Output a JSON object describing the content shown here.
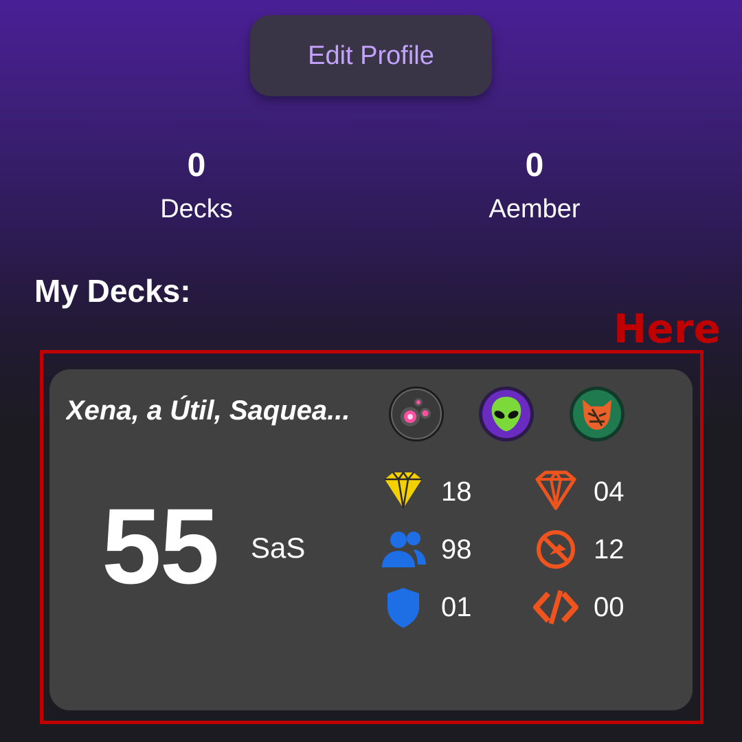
{
  "profile": {
    "edit_button_label": "Edit Profile"
  },
  "stats": [
    {
      "value": "0",
      "label": "Decks"
    },
    {
      "value": "0",
      "label": "Aember"
    }
  ],
  "section_title": "My Decks:",
  "annotation": {
    "label": "Here",
    "color": "#c00000"
  },
  "deck": {
    "name": "Xena, a Útil, Saquea...",
    "houses": [
      "logos-house-icon",
      "mars-house-icon",
      "untamed-house-icon"
    ],
    "sas_score": "55",
    "sas_label": "SaS",
    "stats": [
      {
        "icon": "yellow-aember-gem-icon",
        "value": "18",
        "color": "#f5d000"
      },
      {
        "icon": "orange-aember-gem-icon",
        "value": "04",
        "color": "#f0541e"
      },
      {
        "icon": "creatures-icon",
        "value": "98",
        "color": "#1e6fe6"
      },
      {
        "icon": "no-capture-icon",
        "value": "12",
        "color": "#f0541e"
      },
      {
        "icon": "shield-icon",
        "value": "01",
        "color": "#1e6fe6"
      },
      {
        "icon": "code-icon",
        "value": "00",
        "color": "#f0541e"
      }
    ]
  }
}
